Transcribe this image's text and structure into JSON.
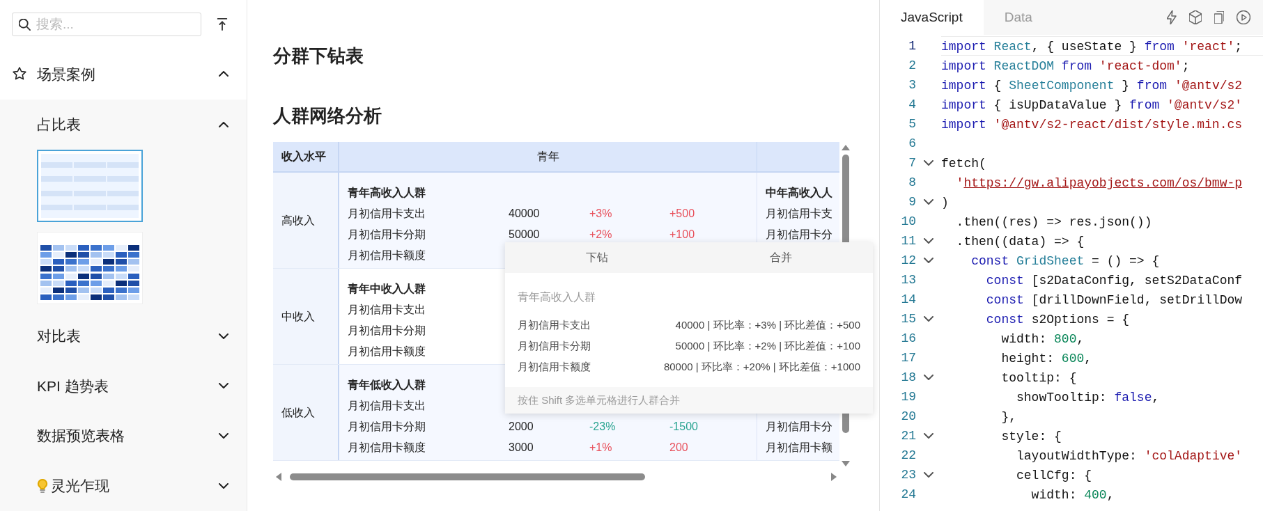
{
  "sidebar": {
    "search": {
      "placeholder": "搜索..."
    },
    "sections": [
      {
        "label": "场景案例",
        "expanded": true,
        "children": [
          {
            "label": "占比表",
            "kind": "plain",
            "expanded": true,
            "thumbnails": [
              {
                "kind": "table",
                "selected": true
              },
              {
                "kind": "heatmap",
                "selected": false
              }
            ]
          },
          {
            "label": "对比表",
            "kind": "plain",
            "expanded": false
          },
          {
            "label": "KPI 趋势表",
            "kind": "plain",
            "expanded": false
          },
          {
            "label": "数据预览表格",
            "kind": "plain",
            "expanded": false
          },
          {
            "label": "灵光乍现",
            "kind": "bulb",
            "expanded": false
          }
        ]
      }
    ]
  },
  "page_title": "分群下钻表",
  "table": {
    "title": "人群网络分析",
    "corner": "收入水平",
    "column_headers": [
      "青年"
    ],
    "rows": [
      {
        "label": "高收入",
        "cells": [
          {
            "group": "青年高收入人群",
            "metrics": [
              {
                "name": "月初信用卡支出",
                "value": "40000",
                "rate": "+3%",
                "diff": "+500",
                "color": "#e8505b"
              },
              {
                "name": "月初信用卡分期",
                "value": "50000",
                "rate": "+2%",
                "diff": "+100",
                "color": "#e8505b"
              },
              {
                "name": "月初信用卡额度"
              }
            ]
          },
          {
            "group": "中年高收入人",
            "metrics": [
              {
                "name": "月初信用卡支"
              },
              {
                "name": "月初信用卡分"
              }
            ]
          }
        ]
      },
      {
        "label": "中收入",
        "cells": [
          {
            "group": "青年中收入人群",
            "metrics": [
              {
                "name": "月初信用卡支出"
              },
              {
                "name": "月初信用卡分期"
              },
              {
                "name": "月初信用卡额度"
              }
            ]
          },
          {}
        ]
      },
      {
        "label": "低收入",
        "cells": [
          {
            "group": "青年低收入人群",
            "metrics": [
              {
                "name": "月初信用卡支出"
              },
              {
                "name": "月初信用卡分期",
                "value": "2000",
                "rate": "-23%",
                "diff": "-1500",
                "color": "#2aa491"
              },
              {
                "name": "月初信用卡额度",
                "value": "3000",
                "rate": "+1%",
                "diff": "200",
                "color": "#e8505b"
              }
            ]
          },
          {
            "metrics": [
              {
                "name": "月初信用卡分"
              },
              {
                "name": "月初信用卡额"
              }
            ]
          }
        ]
      }
    ]
  },
  "tooltip": {
    "actions": [
      "下钻",
      "合并"
    ],
    "title": "青年高收入人群",
    "rows": [
      {
        "label": "月初信用卡支出",
        "value": "40000 | 环比率：+3% | 环比差值：+500"
      },
      {
        "label": "月初信用卡分期",
        "value": "50000 | 环比率：+2% | 环比差值：+100"
      },
      {
        "label": "月初信用卡额度",
        "value": "80000 | 环比率：+20% | 环比差值：+1000"
      }
    ],
    "hint": "按住 Shift 多选单元格进行人群合并"
  },
  "editor": {
    "tabs": [
      {
        "label": "JavaScript",
        "selected": true
      },
      {
        "label": "Data",
        "selected": false
      }
    ],
    "lines": [
      {
        "number": "1",
        "foldable": false,
        "active": true,
        "tokens": [
          {
            "kind": "kw",
            "text": "import"
          },
          {
            "kind": "cls",
            "text": " React"
          },
          {
            "kind": "plain",
            "text": ", { useState } "
          },
          {
            "kind": "kw",
            "text": "from"
          },
          {
            "kind": "str",
            "text": " 'react'"
          },
          {
            "kind": "plain",
            "text": ";"
          }
        ]
      },
      {
        "number": "2",
        "foldable": false,
        "active": false,
        "tokens": [
          {
            "kind": "kw",
            "text": "import"
          },
          {
            "kind": "cls",
            "text": " ReactDOM"
          },
          {
            "kind": "kw",
            "text": " from"
          },
          {
            "kind": "str",
            "text": " 'react-dom'"
          },
          {
            "kind": "plain",
            "text": ";"
          }
        ]
      },
      {
        "number": "3",
        "foldable": false,
        "active": false,
        "tokens": [
          {
            "kind": "kw",
            "text": "import"
          },
          {
            "kind": "plain",
            "text": " {"
          },
          {
            "kind": "cls",
            "text": " SheetComponent"
          },
          {
            "kind": "plain",
            "text": " }"
          },
          {
            "kind": "kw",
            "text": " from"
          },
          {
            "kind": "str",
            "text": " '@antv/s2"
          }
        ]
      },
      {
        "number": "4",
        "foldable": false,
        "active": false,
        "tokens": [
          {
            "kind": "kw",
            "text": "import"
          },
          {
            "kind": "plain",
            "text": " { isUpDataValue }"
          },
          {
            "kind": "kw",
            "text": " from"
          },
          {
            "kind": "str",
            "text": " '@antv/s2'"
          }
        ]
      },
      {
        "number": "5",
        "foldable": false,
        "active": false,
        "tokens": [
          {
            "kind": "kw",
            "text": "import"
          },
          {
            "kind": "str",
            "text": " '@antv/s2-react/dist/style.min.cs"
          }
        ]
      },
      {
        "number": "6",
        "foldable": false,
        "active": false
      },
      {
        "number": "7",
        "foldable": true,
        "active": false,
        "tokens": [
          {
            "kind": "plain",
            "text": "fetch("
          }
        ]
      },
      {
        "number": "8",
        "foldable": false,
        "active": false,
        "tokens": [
          {
            "kind": "str",
            "text": "  '"
          },
          {
            "kind": "url",
            "text": "https://gw.alipayobjects.com/os/bmw-p"
          }
        ]
      },
      {
        "number": "9",
        "foldable": true,
        "active": false,
        "tokens": [
          {
            "kind": "plain",
            "text": ")"
          }
        ]
      },
      {
        "number": "10",
        "foldable": false,
        "active": false,
        "tokens": [
          {
            "kind": "plain",
            "text": "  .then((res) => res.json())"
          }
        ]
      },
      {
        "number": "11",
        "foldable": true,
        "active": false,
        "tokens": [
          {
            "kind": "plain",
            "text": "  .then((data) => {"
          }
        ]
      },
      {
        "number": "12",
        "foldable": true,
        "active": false,
        "tokens": [
          {
            "kind": "kw",
            "text": "    const"
          },
          {
            "kind": "cls",
            "text": " GridSheet"
          },
          {
            "kind": "plain",
            "text": " = () => {"
          }
        ]
      },
      {
        "number": "13",
        "foldable": false,
        "active": false,
        "tokens": [
          {
            "kind": "kw",
            "text": "      const"
          },
          {
            "kind": "plain",
            "text": " [s2DataConfig, setS2DataConf"
          }
        ]
      },
      {
        "number": "14",
        "foldable": false,
        "active": false,
        "tokens": [
          {
            "kind": "kw",
            "text": "      const"
          },
          {
            "kind": "plain",
            "text": " [drillDownField, setDrillDow"
          }
        ]
      },
      {
        "number": "15",
        "foldable": true,
        "active": false,
        "tokens": [
          {
            "kind": "kw",
            "text": "      const"
          },
          {
            "kind": "plain",
            "text": " s2Options = {"
          }
        ]
      },
      {
        "number": "16",
        "foldable": false,
        "active": false,
        "tokens": [
          {
            "kind": "plain",
            "text": "        width:"
          },
          {
            "kind": "num",
            "text": " 800"
          },
          {
            "kind": "plain",
            "text": ","
          }
        ]
      },
      {
        "number": "17",
        "foldable": false,
        "active": false,
        "tokens": [
          {
            "kind": "plain",
            "text": "        height:"
          },
          {
            "kind": "num",
            "text": " 600"
          },
          {
            "kind": "plain",
            "text": ","
          }
        ]
      },
      {
        "number": "18",
        "foldable": true,
        "active": false,
        "tokens": [
          {
            "kind": "plain",
            "text": "        tooltip: {"
          }
        ]
      },
      {
        "number": "19",
        "foldable": false,
        "active": false,
        "tokens": [
          {
            "kind": "plain",
            "text": "          showTooltip:"
          },
          {
            "kind": "kw",
            "text": " false"
          },
          {
            "kind": "plain",
            "text": ","
          }
        ]
      },
      {
        "number": "20",
        "foldable": false,
        "active": false,
        "tokens": [
          {
            "kind": "plain",
            "text": "        },"
          }
        ]
      },
      {
        "number": "21",
        "foldable": true,
        "active": false,
        "tokens": [
          {
            "kind": "plain",
            "text": "        style: {"
          }
        ]
      },
      {
        "number": "22",
        "foldable": false,
        "active": false,
        "tokens": [
          {
            "kind": "plain",
            "text": "          layoutWidthType:"
          },
          {
            "kind": "str",
            "text": " 'colAdaptive'"
          }
        ]
      },
      {
        "number": "23",
        "foldable": true,
        "active": false,
        "tokens": [
          {
            "kind": "plain",
            "text": "          cellCfg: {"
          }
        ]
      },
      {
        "number": "24",
        "foldable": false,
        "active": false,
        "tokens": [
          {
            "kind": "plain",
            "text": "            width:"
          },
          {
            "kind": "num",
            "text": " 400"
          },
          {
            "kind": "plain",
            "text": ","
          }
        ]
      }
    ]
  }
}
